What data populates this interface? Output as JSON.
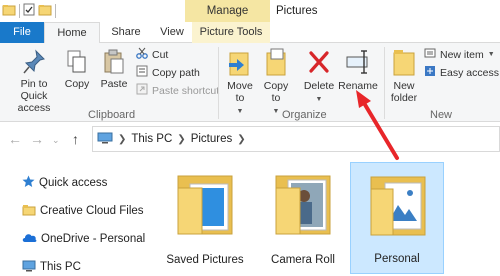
{
  "window": {
    "title": "Pictures",
    "context_tab_group": "Manage"
  },
  "ribbon_tabs": [
    {
      "label": "File"
    },
    {
      "label": "Home"
    },
    {
      "label": "Share"
    },
    {
      "label": "View"
    },
    {
      "label": "Picture Tools"
    }
  ],
  "ribbon": {
    "clipboard": {
      "label": "Clipboard",
      "pin_label": "Pin to Quick access",
      "copy_label": "Copy",
      "paste_label": "Paste",
      "cut_label": "Cut",
      "copy_path_label": "Copy path",
      "paste_shortcut_label": "Paste shortcut"
    },
    "organize": {
      "label": "Organize",
      "move_to_label": "Move to",
      "copy_to_label": "Copy to",
      "delete_label": "Delete",
      "rename_label": "Rename"
    },
    "new": {
      "label": "New",
      "new_folder_label": "New folder",
      "new_item_label": "New item",
      "easy_access_label": "Easy access"
    }
  },
  "address_bar": {
    "crumbs": [
      "This PC",
      "Pictures"
    ]
  },
  "sidebar": {
    "items": [
      {
        "label": "Quick access",
        "icon": "star-icon"
      },
      {
        "label": "Creative Cloud Files",
        "icon": "folder-icon"
      },
      {
        "label": "OneDrive - Personal",
        "icon": "cloud-icon"
      },
      {
        "label": "This PC",
        "icon": "pc-icon"
      }
    ]
  },
  "folders": [
    {
      "label": "Saved Pictures",
      "selected": false
    },
    {
      "label": "Camera Roll",
      "selected": false
    },
    {
      "label": "Personal",
      "selected": true
    }
  ],
  "colors": {
    "accent": "#1979ca",
    "manage": "#f5e6a3",
    "selection": "#cce8ff",
    "arrow": "#e8262a",
    "folder": "#f6d675"
  }
}
